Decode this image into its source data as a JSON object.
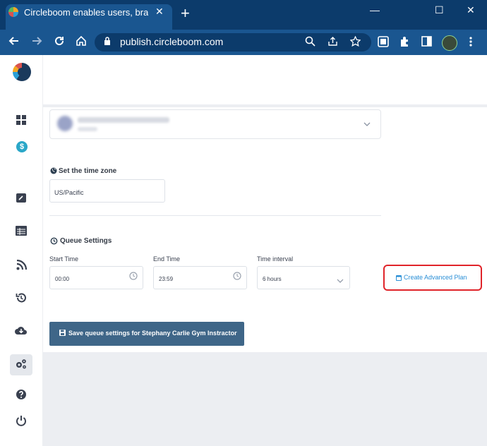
{
  "browser": {
    "tab_title": "Circleboom enables users, brand",
    "tab_close": "✕",
    "new_tab": "+",
    "window_controls": {
      "minimize": "—",
      "maximize": "☐",
      "close": "✕"
    },
    "url": "publish.circleboom.com",
    "icons": [
      "back-icon",
      "forward-icon",
      "reload-icon",
      "home-icon",
      "lock-icon",
      "zoom-icon",
      "share-icon",
      "star-icon",
      "screenshot-icon",
      "extensions-icon",
      "sidepanel-icon",
      "profile-avatar",
      "kebab-menu-icon"
    ]
  },
  "sidebar": {
    "items": [
      {
        "name": "dashboard",
        "icon": "grid-icon"
      },
      {
        "name": "pricing",
        "icon": "dollar-icon",
        "glyph": "$"
      },
      {
        "name": "compose",
        "icon": "compose-icon"
      },
      {
        "name": "queue",
        "icon": "table-icon"
      },
      {
        "name": "rss",
        "icon": "rss-icon"
      },
      {
        "name": "history",
        "icon": "history-icon"
      },
      {
        "name": "download",
        "icon": "cloud-download-icon"
      },
      {
        "name": "settings",
        "icon": "gears-icon",
        "active": true
      },
      {
        "name": "help",
        "icon": "help-icon"
      },
      {
        "name": "logout",
        "icon": "power-icon"
      }
    ]
  },
  "account_selector": {
    "chevron": "⌄"
  },
  "timezone": {
    "title": "Set the time zone",
    "value": "US/Pacific"
  },
  "queue": {
    "title": "Queue Settings",
    "start_label": "Start Time",
    "start_value": "00:00",
    "end_label": "End Time",
    "end_value": "23:59",
    "interval_label": "Time interval",
    "interval_value": "6 hours",
    "advanced_plan": "Create Advanced Plan",
    "save_label": "Save queue settings for Stephany Carlie Gym Instractor"
  },
  "colors": {
    "tabstrip": "#0c3b6b",
    "toolbar": "#1a5690",
    "content_bg": "#eceef2",
    "save_button": "#3f6688",
    "link": "#2a8fd6",
    "highlight": "#e0242a"
  }
}
